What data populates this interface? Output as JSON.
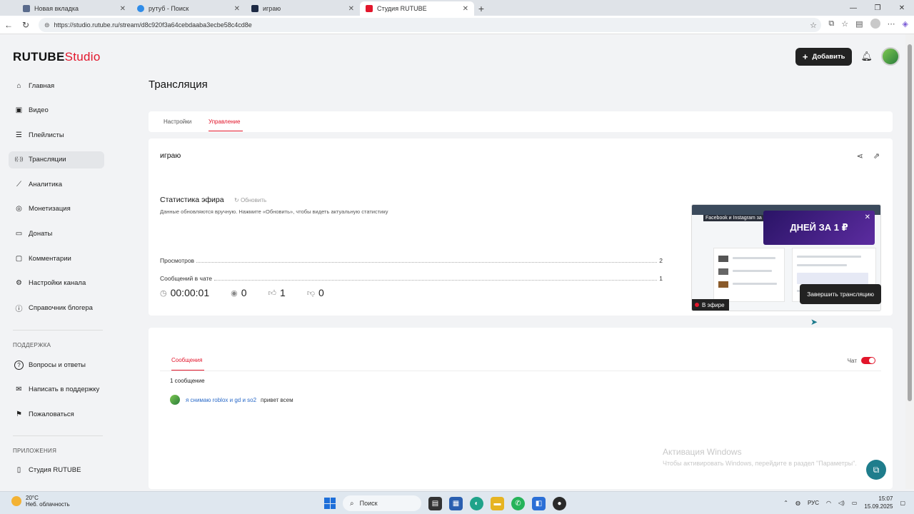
{
  "browser": {
    "tabs": [
      {
        "title": "Новая вкладка",
        "color": "#5a6b8c"
      },
      {
        "title": "рутуб - Поиск",
        "color": "#2f8ce8"
      },
      {
        "title": "играю",
        "color": "#1d2a44"
      },
      {
        "title": "Студия RUTUBE",
        "color": "#e2162b"
      }
    ],
    "url": "https://studio.rutube.ru/stream/d8c920f3a64cebdaaba3ecbe58c4cd8e"
  },
  "logo": {
    "main": "RUTUBE",
    "accent": "Studio"
  },
  "sidebar": {
    "items": [
      {
        "label": "Главная",
        "icon": "home-icon",
        "glyph": "⌂"
      },
      {
        "label": "Видео",
        "icon": "video-icon",
        "glyph": "▣"
      },
      {
        "label": "Плейлисты",
        "icon": "playlist-icon",
        "glyph": "☰"
      },
      {
        "label": "Трансляции",
        "icon": "broadcast-icon",
        "glyph": "((·))"
      },
      {
        "label": "Аналитика",
        "icon": "analytics-icon",
        "glyph": "⟋"
      },
      {
        "label": "Монетизация",
        "icon": "monetization-icon",
        "glyph": "◎"
      },
      {
        "label": "Донаты",
        "icon": "donate-icon",
        "glyph": "▭"
      },
      {
        "label": "Комментарии",
        "icon": "comments-icon",
        "glyph": "▢"
      },
      {
        "label": "Настройки канала",
        "icon": "gear-icon",
        "glyph": "⚙"
      },
      {
        "label": "Справочник блогера",
        "icon": "info-icon",
        "glyph": "ⓘ"
      }
    ],
    "support_heading": "ПОДДЕРЖКА",
    "support_items": [
      {
        "label": "Вопросы и ответы",
        "icon": "question-icon",
        "glyph": "?"
      },
      {
        "label": "Написать в поддержку",
        "icon": "mail-icon",
        "glyph": "✉"
      },
      {
        "label": "Пожаловаться",
        "icon": "flag-icon",
        "glyph": "⚑"
      }
    ],
    "apps_heading": "ПРИЛОЖЕНИЯ",
    "apps_items": [
      {
        "label": "Студия RUTUBE",
        "icon": "phone-icon",
        "glyph": "▯"
      }
    ]
  },
  "header": {
    "add_label": "Добавить"
  },
  "page": {
    "title": "Трансляция",
    "tabs": [
      {
        "label": "Настройки"
      },
      {
        "label": "Управление"
      }
    ]
  },
  "stream": {
    "name": "играю",
    "stats_title": "Статистика эфира",
    "refresh_label": "Обновить",
    "stats_note": "Данные обновляются вручную. Нажмите «Обновить», чтобы видеть актуальную статистику",
    "stats": [
      {
        "label": "Просмотров",
        "value": "2"
      },
      {
        "label": "Сообщений в чате",
        "value": "1"
      }
    ],
    "duration": "00:00:01",
    "viewers": "0",
    "likes": "1",
    "dislikes": "0",
    "live_label": "В эфире",
    "end_label": "Завершить трансляцию",
    "preview": {
      "fb_text": "Facebook и Instagram за",
      "promo_text": "ДНЕЙ ЗА 1 ₽"
    }
  },
  "chat": {
    "tab_label": "Сообщения",
    "toggle_label": "Чат",
    "count_label": "1 сообщение",
    "messages": [
      {
        "author": "я снимаю roblox и gd и so2",
        "text": "привет всем"
      }
    ]
  },
  "watermark": {
    "line1": "Активация Windows",
    "line2": "Чтобы активировать Windows, перейдите в раздел \"Параметры\"."
  },
  "taskbar": {
    "temp": "20°C",
    "weather": "Неб. облачность",
    "search": "Поиск",
    "lang": "РУС",
    "time": "15:07",
    "date": "15.09.2025"
  }
}
